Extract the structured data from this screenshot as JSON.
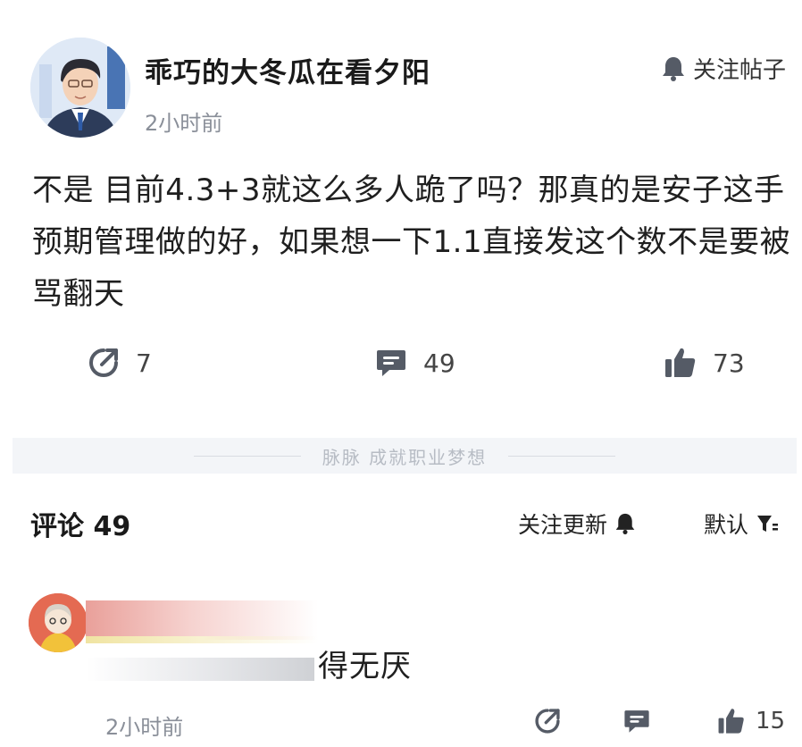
{
  "post": {
    "author": "乖巧的大冬瓜在看夕阳",
    "time": "2小时前",
    "follow_label": "关注帖子",
    "body": "不是  目前4.3+3就这么多人跪了吗？那真的是安子这手预期管理做的好，如果想一下1.1直接发这个数不是要被骂翻天",
    "share_count": "7",
    "comment_count": "49",
    "like_count": "73"
  },
  "divider_text": "脉脉  成就职业梦想",
  "comments": {
    "title": "评论 49",
    "follow_updates_label": "关注更新",
    "sort_label": "默认",
    "items": [
      {
        "text": "得无厌",
        "time": "2小时前",
        "like_count": "15"
      }
    ]
  },
  "colors": {
    "text": "#1f1f1f",
    "muted": "#8a8f99",
    "icon": "#555b66",
    "divider_bg": "#f3f5f8"
  }
}
